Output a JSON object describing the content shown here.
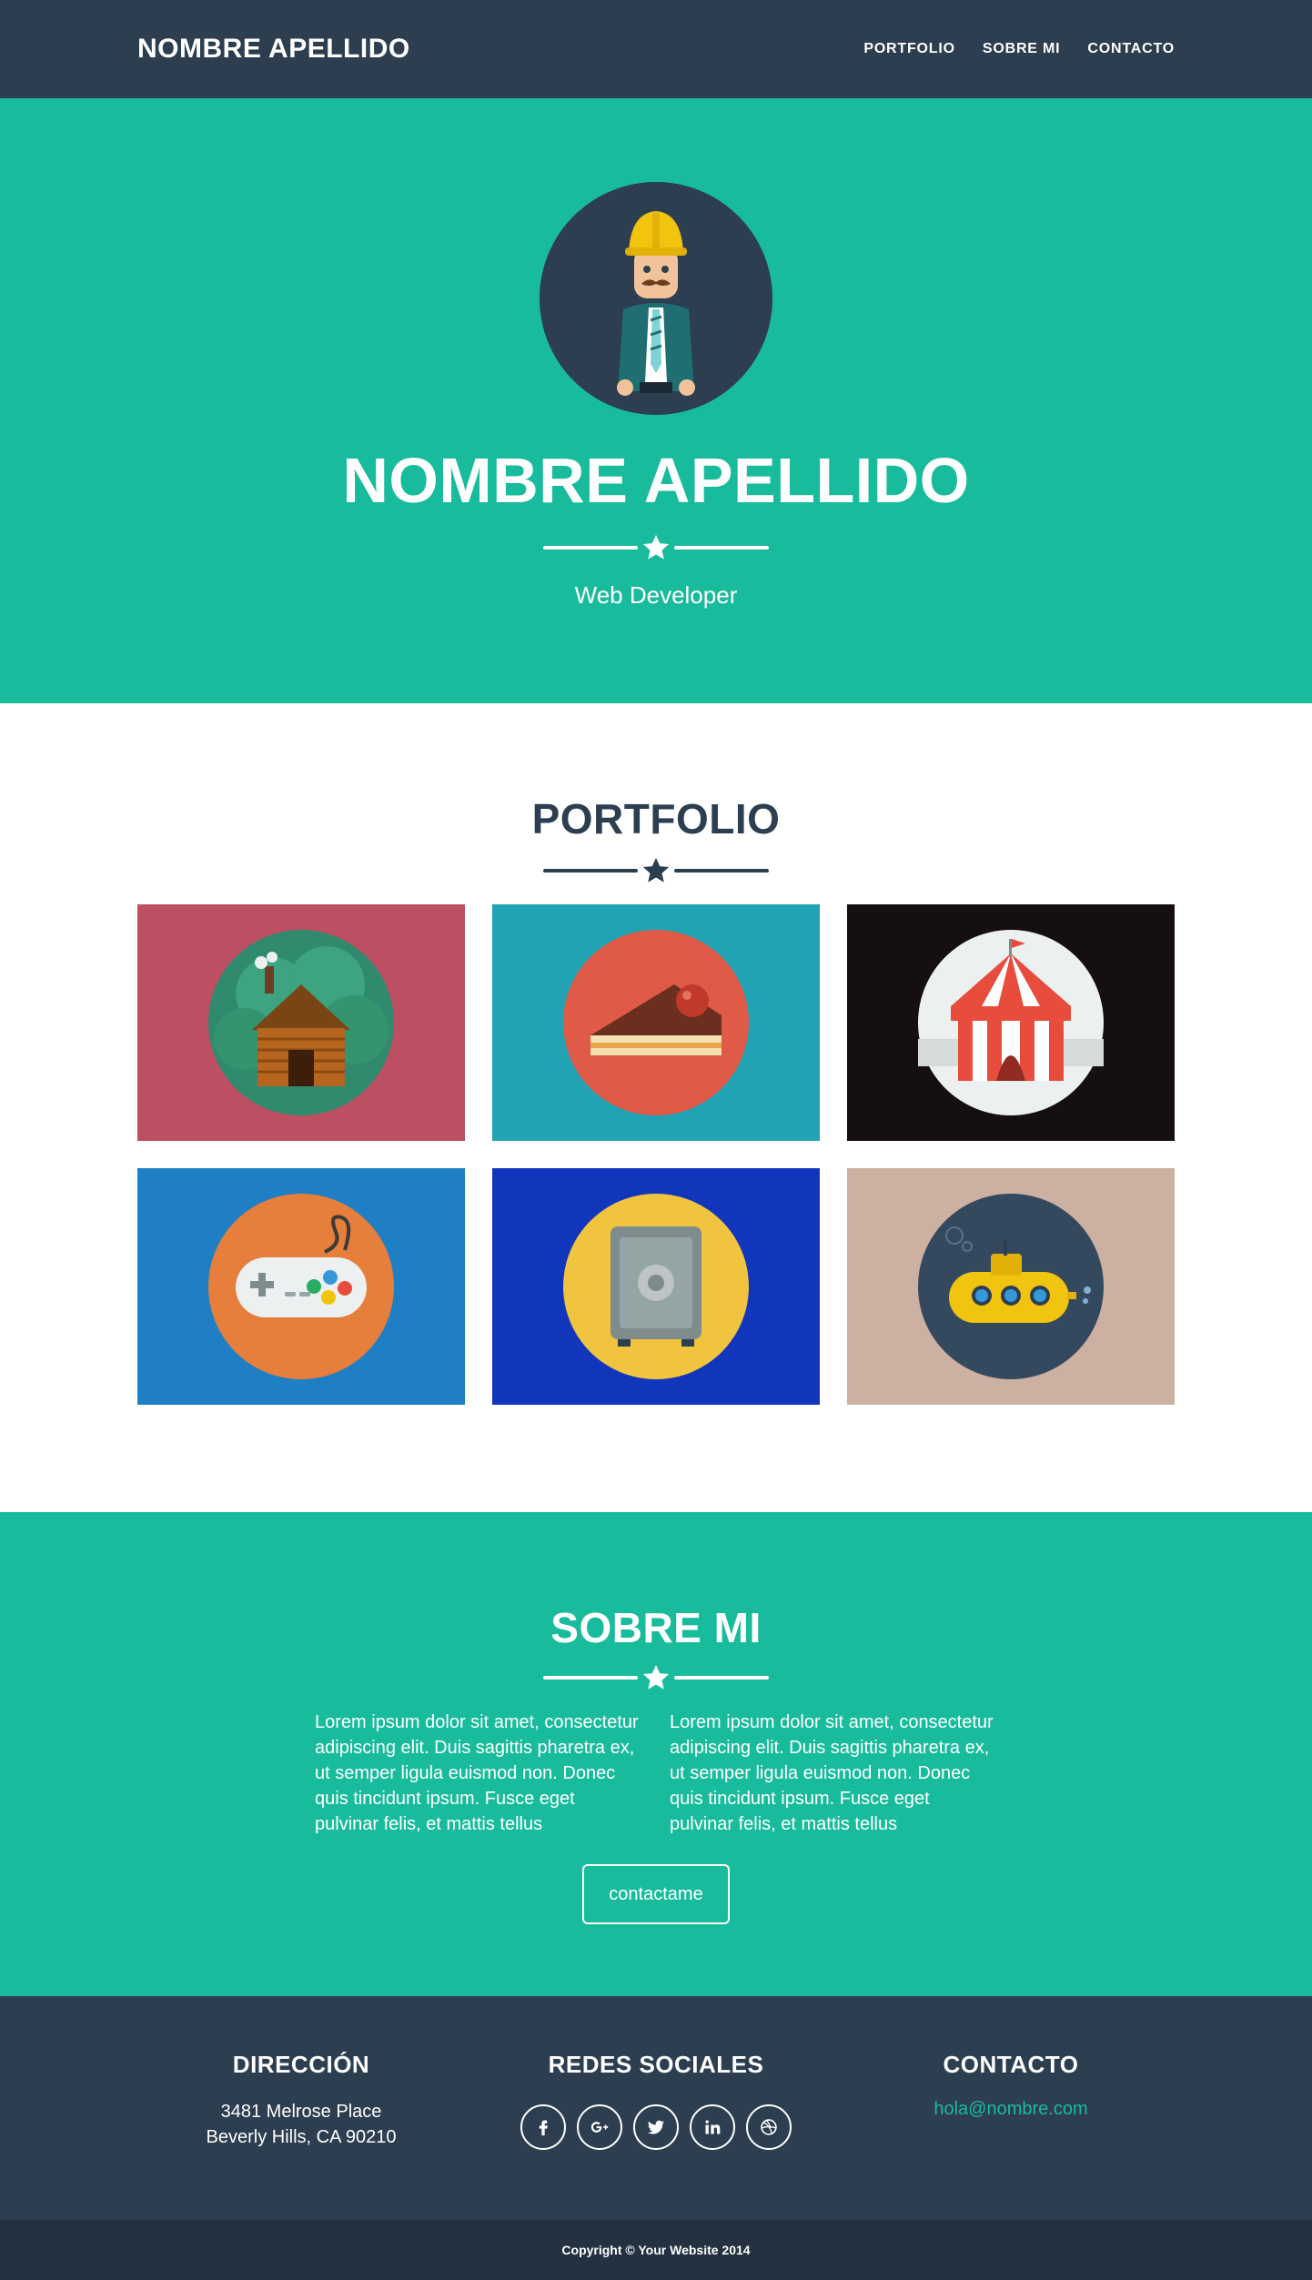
{
  "nav": {
    "brand": "NOMBRE APELLIDO",
    "links": [
      "PORTFOLIO",
      "SOBRE MI",
      "CONTACTO"
    ]
  },
  "hero": {
    "title": "NOMBRE APELLIDO",
    "subtitle": "Web Developer",
    "avatar_icon": "developer-avatar-icon",
    "divider_icon": "star-icon"
  },
  "portfolio": {
    "title": "PORTFOLIO",
    "items": [
      {
        "icon": "log-cabin-icon",
        "bg": "#bd4f63"
      },
      {
        "icon": "cake-slice-icon",
        "bg": "#21a3b4"
      },
      {
        "icon": "circus-tent-icon",
        "bg": "#150f0f"
      },
      {
        "icon": "game-controller-icon",
        "bg": "#1e7fc4"
      },
      {
        "icon": "safe-icon",
        "bg": "#1135bb"
      },
      {
        "icon": "submarine-icon",
        "bg": "#ccb0a1"
      }
    ]
  },
  "about": {
    "title": "SOBRE MI",
    "col1": "Lorem ipsum dolor sit amet, consectetur adipiscing elit. Duis sagittis pharetra ex, ut semper ligula euismod non. Donec quis tincidunt ipsum. Fusce eget pulvinar felis, et mattis tellus",
    "col2": "Lorem ipsum dolor sit amet, consectetur adipiscing elit. Duis sagittis pharetra ex, ut semper ligula euismod non. Donec quis tincidunt ipsum. Fusce eget pulvinar felis, et mattis tellus",
    "button": "contactame"
  },
  "footer": {
    "address_title": "DIRECCIÓN",
    "address_line1": "3481 Melrose Place",
    "address_line2": "Beverly Hills, CA 90210",
    "social_title": "REDES SOCIALES",
    "social_icons": [
      "facebook-icon",
      "google-plus-icon",
      "twitter-icon",
      "linkedin-icon",
      "dribbble-icon"
    ],
    "contact_title": "CONTACTO",
    "email": "hola@nombre.com"
  },
  "copyright": "Copyright © Your Website 2014",
  "colors": {
    "primary": "#2c3e50",
    "accent": "#18bc9c",
    "copyright_bg": "#233140"
  }
}
